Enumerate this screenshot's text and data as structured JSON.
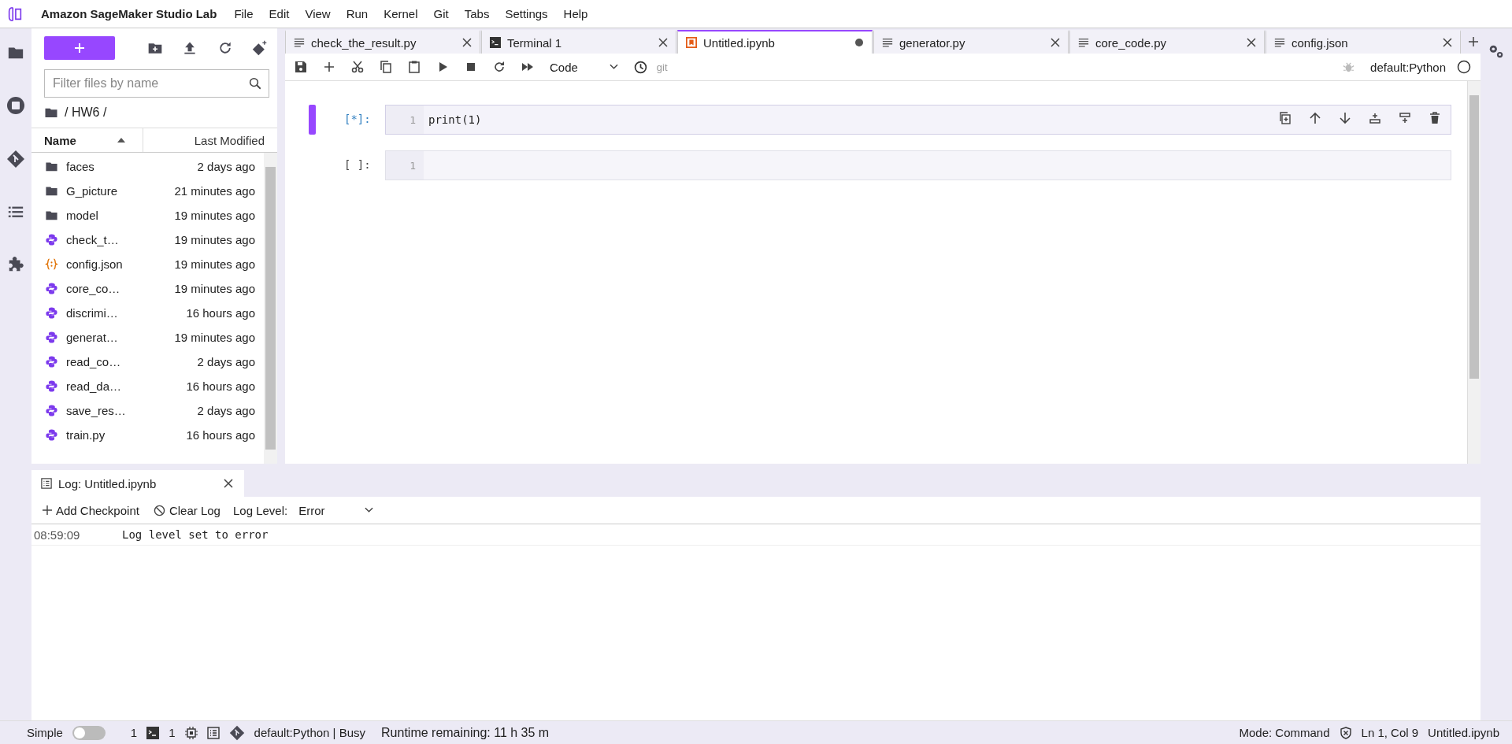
{
  "app_title": "Amazon SageMaker Studio Lab",
  "menu": [
    "File",
    "Edit",
    "View",
    "Run",
    "Kernel",
    "Git",
    "Tabs",
    "Settings",
    "Help"
  ],
  "file_browser": {
    "filter_placeholder": "Filter files by name",
    "breadcrumb": "/ HW6 /",
    "name_column": "Name",
    "modified_column": "Last Modified",
    "files": [
      {
        "name": "faces",
        "modified": "2 days ago",
        "kind": "folder"
      },
      {
        "name": "G_picture",
        "modified": "21 minutes ago",
        "kind": "folder"
      },
      {
        "name": "model",
        "modified": "19 minutes ago",
        "kind": "folder"
      },
      {
        "name": "check_t…",
        "modified": "19 minutes ago",
        "kind": "python"
      },
      {
        "name": "config.json",
        "modified": "19 minutes ago",
        "kind": "json"
      },
      {
        "name": "core_co…",
        "modified": "19 minutes ago",
        "kind": "python"
      },
      {
        "name": "discrimi…",
        "modified": "16 hours ago",
        "kind": "python"
      },
      {
        "name": "generat…",
        "modified": "19 minutes ago",
        "kind": "python"
      },
      {
        "name": "read_co…",
        "modified": "2 days ago",
        "kind": "python"
      },
      {
        "name": "read_da…",
        "modified": "16 hours ago",
        "kind": "python"
      },
      {
        "name": "save_res…",
        "modified": "2 days ago",
        "kind": "python"
      },
      {
        "name": "train.py",
        "modified": "16 hours ago",
        "kind": "python"
      }
    ]
  },
  "tabs": [
    {
      "label": "check_the_result.py",
      "kind": "text",
      "selected": false,
      "modified": false
    },
    {
      "label": "Terminal 1",
      "kind": "terminal",
      "selected": false,
      "modified": false
    },
    {
      "label": "Untitled.ipynb",
      "kind": "notebook",
      "selected": true,
      "modified": true
    },
    {
      "label": "generator.py",
      "kind": "text",
      "selected": false,
      "modified": false
    },
    {
      "label": "core_code.py",
      "kind": "text",
      "selected": false,
      "modified": false
    },
    {
      "label": "config.json",
      "kind": "text",
      "selected": false,
      "modified": false
    }
  ],
  "notebook_toolbar": {
    "cell_type": "Code",
    "git": "git",
    "kernel": "default:Python"
  },
  "cells": [
    {
      "prompt": "[*]:",
      "line_number": "1",
      "code": "print(1)",
      "selected": true
    },
    {
      "prompt": "[ ]:",
      "line_number": "1",
      "selected": false
    }
  ],
  "log": {
    "title": "Log: Untitled.ipynb",
    "add_checkpoint": "Add Checkpoint",
    "clear_log": "Clear Log",
    "level_label": "Log Level:",
    "level_value": "Error",
    "entries": [
      {
        "time": "08:59:09",
        "message": "Log level set to error"
      }
    ]
  },
  "status_bar": {
    "simple_label": "Simple",
    "simple_mode": false,
    "terminals": "1",
    "kernels": "1",
    "kernel_status": "default:Python | Busy",
    "runtime": "Runtime remaining: 11 h 35 m",
    "mode": "Mode: Command",
    "position": "Ln 1, Col 9",
    "file": "Untitled.ipynb"
  }
}
